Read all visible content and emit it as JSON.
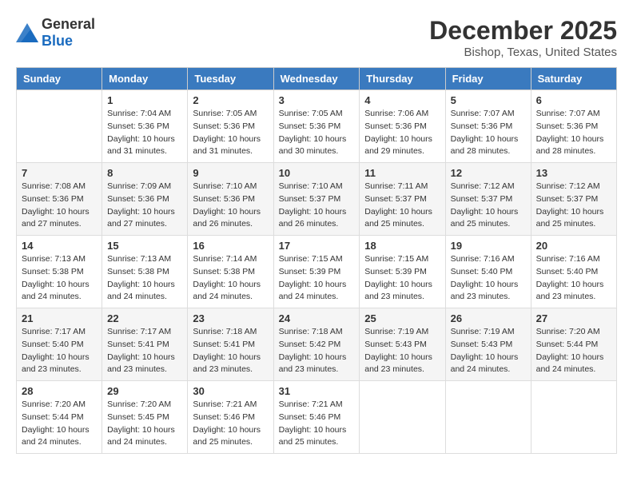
{
  "logo": {
    "general": "General",
    "blue": "Blue"
  },
  "title": "December 2025",
  "subtitle": "Bishop, Texas, United States",
  "days_of_week": [
    "Sunday",
    "Monday",
    "Tuesday",
    "Wednesday",
    "Thursday",
    "Friday",
    "Saturday"
  ],
  "weeks": [
    [
      {
        "day": "",
        "sunrise": "",
        "sunset": "",
        "daylight": ""
      },
      {
        "day": "1",
        "sunrise": "Sunrise: 7:04 AM",
        "sunset": "Sunset: 5:36 PM",
        "daylight": "Daylight: 10 hours and 31 minutes."
      },
      {
        "day": "2",
        "sunrise": "Sunrise: 7:05 AM",
        "sunset": "Sunset: 5:36 PM",
        "daylight": "Daylight: 10 hours and 31 minutes."
      },
      {
        "day": "3",
        "sunrise": "Sunrise: 7:05 AM",
        "sunset": "Sunset: 5:36 PM",
        "daylight": "Daylight: 10 hours and 30 minutes."
      },
      {
        "day": "4",
        "sunrise": "Sunrise: 7:06 AM",
        "sunset": "Sunset: 5:36 PM",
        "daylight": "Daylight: 10 hours and 29 minutes."
      },
      {
        "day": "5",
        "sunrise": "Sunrise: 7:07 AM",
        "sunset": "Sunset: 5:36 PM",
        "daylight": "Daylight: 10 hours and 28 minutes."
      },
      {
        "day": "6",
        "sunrise": "Sunrise: 7:07 AM",
        "sunset": "Sunset: 5:36 PM",
        "daylight": "Daylight: 10 hours and 28 minutes."
      }
    ],
    [
      {
        "day": "7",
        "sunrise": "Sunrise: 7:08 AM",
        "sunset": "Sunset: 5:36 PM",
        "daylight": "Daylight: 10 hours and 27 minutes."
      },
      {
        "day": "8",
        "sunrise": "Sunrise: 7:09 AM",
        "sunset": "Sunset: 5:36 PM",
        "daylight": "Daylight: 10 hours and 27 minutes."
      },
      {
        "day": "9",
        "sunrise": "Sunrise: 7:10 AM",
        "sunset": "Sunset: 5:36 PM",
        "daylight": "Daylight: 10 hours and 26 minutes."
      },
      {
        "day": "10",
        "sunrise": "Sunrise: 7:10 AM",
        "sunset": "Sunset: 5:37 PM",
        "daylight": "Daylight: 10 hours and 26 minutes."
      },
      {
        "day": "11",
        "sunrise": "Sunrise: 7:11 AM",
        "sunset": "Sunset: 5:37 PM",
        "daylight": "Daylight: 10 hours and 25 minutes."
      },
      {
        "day": "12",
        "sunrise": "Sunrise: 7:12 AM",
        "sunset": "Sunset: 5:37 PM",
        "daylight": "Daylight: 10 hours and 25 minutes."
      },
      {
        "day": "13",
        "sunrise": "Sunrise: 7:12 AM",
        "sunset": "Sunset: 5:37 PM",
        "daylight": "Daylight: 10 hours and 25 minutes."
      }
    ],
    [
      {
        "day": "14",
        "sunrise": "Sunrise: 7:13 AM",
        "sunset": "Sunset: 5:38 PM",
        "daylight": "Daylight: 10 hours and 24 minutes."
      },
      {
        "day": "15",
        "sunrise": "Sunrise: 7:13 AM",
        "sunset": "Sunset: 5:38 PM",
        "daylight": "Daylight: 10 hours and 24 minutes."
      },
      {
        "day": "16",
        "sunrise": "Sunrise: 7:14 AM",
        "sunset": "Sunset: 5:38 PM",
        "daylight": "Daylight: 10 hours and 24 minutes."
      },
      {
        "day": "17",
        "sunrise": "Sunrise: 7:15 AM",
        "sunset": "Sunset: 5:39 PM",
        "daylight": "Daylight: 10 hours and 24 minutes."
      },
      {
        "day": "18",
        "sunrise": "Sunrise: 7:15 AM",
        "sunset": "Sunset: 5:39 PM",
        "daylight": "Daylight: 10 hours and 23 minutes."
      },
      {
        "day": "19",
        "sunrise": "Sunrise: 7:16 AM",
        "sunset": "Sunset: 5:40 PM",
        "daylight": "Daylight: 10 hours and 23 minutes."
      },
      {
        "day": "20",
        "sunrise": "Sunrise: 7:16 AM",
        "sunset": "Sunset: 5:40 PM",
        "daylight": "Daylight: 10 hours and 23 minutes."
      }
    ],
    [
      {
        "day": "21",
        "sunrise": "Sunrise: 7:17 AM",
        "sunset": "Sunset: 5:40 PM",
        "daylight": "Daylight: 10 hours and 23 minutes."
      },
      {
        "day": "22",
        "sunrise": "Sunrise: 7:17 AM",
        "sunset": "Sunset: 5:41 PM",
        "daylight": "Daylight: 10 hours and 23 minutes."
      },
      {
        "day": "23",
        "sunrise": "Sunrise: 7:18 AM",
        "sunset": "Sunset: 5:41 PM",
        "daylight": "Daylight: 10 hours and 23 minutes."
      },
      {
        "day": "24",
        "sunrise": "Sunrise: 7:18 AM",
        "sunset": "Sunset: 5:42 PM",
        "daylight": "Daylight: 10 hours and 23 minutes."
      },
      {
        "day": "25",
        "sunrise": "Sunrise: 7:19 AM",
        "sunset": "Sunset: 5:43 PM",
        "daylight": "Daylight: 10 hours and 23 minutes."
      },
      {
        "day": "26",
        "sunrise": "Sunrise: 7:19 AM",
        "sunset": "Sunset: 5:43 PM",
        "daylight": "Daylight: 10 hours and 24 minutes."
      },
      {
        "day": "27",
        "sunrise": "Sunrise: 7:20 AM",
        "sunset": "Sunset: 5:44 PM",
        "daylight": "Daylight: 10 hours and 24 minutes."
      }
    ],
    [
      {
        "day": "28",
        "sunrise": "Sunrise: 7:20 AM",
        "sunset": "Sunset: 5:44 PM",
        "daylight": "Daylight: 10 hours and 24 minutes."
      },
      {
        "day": "29",
        "sunrise": "Sunrise: 7:20 AM",
        "sunset": "Sunset: 5:45 PM",
        "daylight": "Daylight: 10 hours and 24 minutes."
      },
      {
        "day": "30",
        "sunrise": "Sunrise: 7:21 AM",
        "sunset": "Sunset: 5:46 PM",
        "daylight": "Daylight: 10 hours and 25 minutes."
      },
      {
        "day": "31",
        "sunrise": "Sunrise: 7:21 AM",
        "sunset": "Sunset: 5:46 PM",
        "daylight": "Daylight: 10 hours and 25 minutes."
      },
      {
        "day": "",
        "sunrise": "",
        "sunset": "",
        "daylight": ""
      },
      {
        "day": "",
        "sunrise": "",
        "sunset": "",
        "daylight": ""
      },
      {
        "day": "",
        "sunrise": "",
        "sunset": "",
        "daylight": ""
      }
    ]
  ]
}
